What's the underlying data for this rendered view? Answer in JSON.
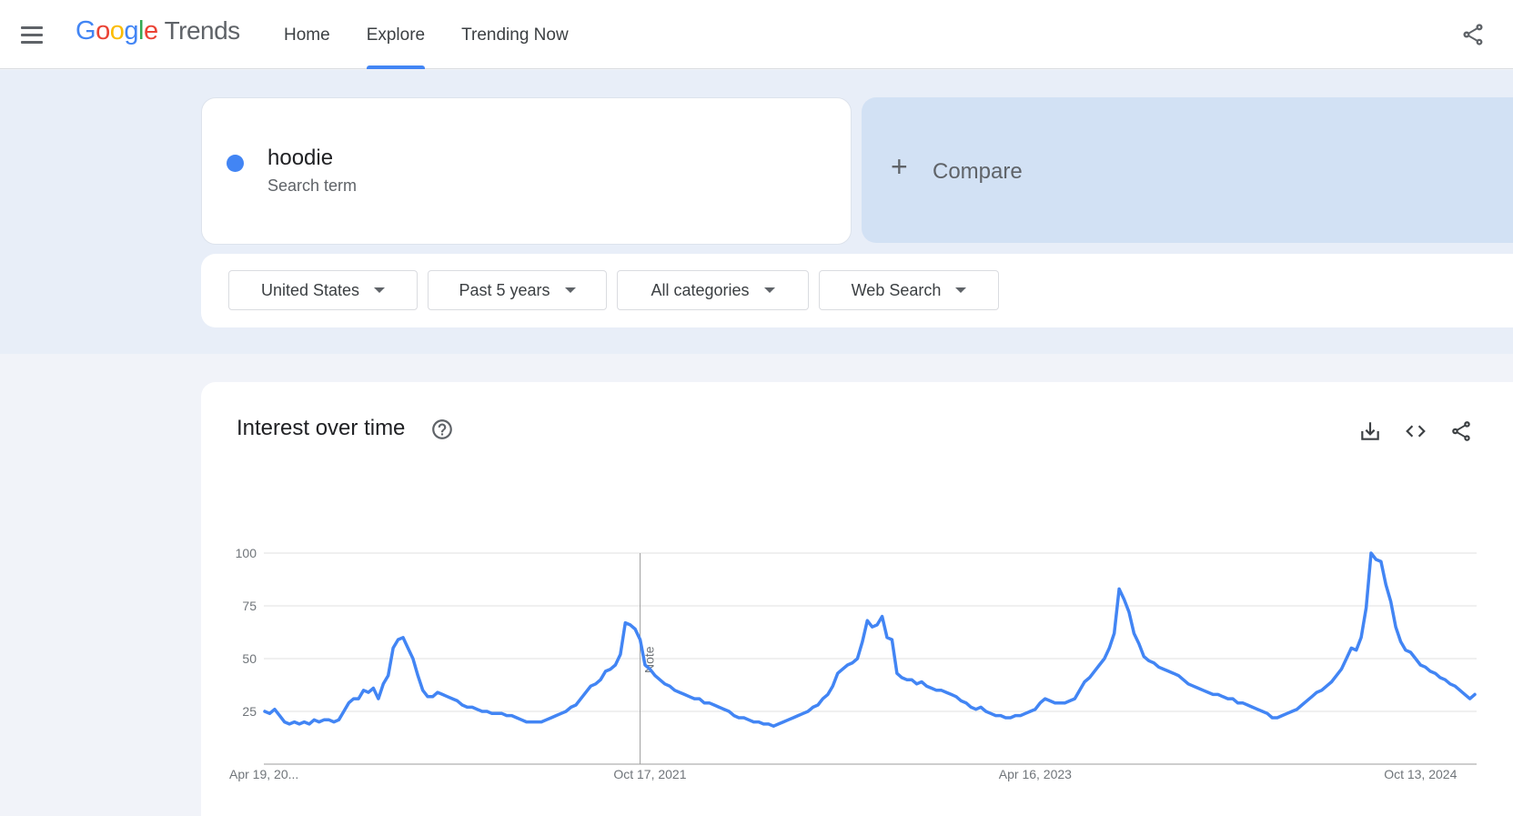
{
  "header": {
    "logo_google": [
      "G",
      "o",
      "o",
      "g",
      "l",
      "e"
    ],
    "logo_product": "Trends",
    "nav": [
      "Home",
      "Explore",
      "Trending Now"
    ]
  },
  "search": {
    "term": "hoodie",
    "term_type": "Search term",
    "term_color": "#4285f4",
    "compare_label": "Compare"
  },
  "filters": [
    "United States",
    "Past 5 years",
    "All categories",
    "Web Search"
  ],
  "chart_section": {
    "title": "Interest over time",
    "note_label": "Note"
  },
  "chart_data": {
    "type": "line",
    "title": "Interest over time",
    "x_tick_labels": [
      "Apr 19, 20...",
      "Oct 17, 2021",
      "Apr 16, 2023",
      "Oct 13, 2024"
    ],
    "y_tick_labels": [
      "100",
      "75",
      "50",
      "25"
    ],
    "ylim": [
      0,
      100
    ],
    "grid": true,
    "series": [
      {
        "name": "hoodie",
        "color": "#4285f4",
        "values": [
          25,
          24,
          26,
          23,
          20,
          19,
          20,
          19,
          20,
          19,
          21,
          20,
          21,
          21,
          20,
          21,
          25,
          29,
          31,
          31,
          35,
          34,
          36,
          31,
          38,
          42,
          55,
          59,
          60,
          55,
          50,
          42,
          35,
          32,
          32,
          34,
          33,
          32,
          31,
          30,
          28,
          27,
          27,
          26,
          25,
          25,
          24,
          24,
          24,
          23,
          23,
          22,
          21,
          20,
          20,
          20,
          20,
          21,
          22,
          23,
          24,
          25,
          27,
          28,
          31,
          34,
          37,
          38,
          40,
          44,
          45,
          47,
          52,
          67,
          66,
          64,
          59,
          47,
          45,
          42,
          40,
          38,
          37,
          35,
          34,
          33,
          32,
          31,
          31,
          29,
          29,
          28,
          27,
          26,
          25,
          23,
          22,
          22,
          21,
          20,
          20,
          19,
          19,
          18,
          19,
          20,
          21,
          22,
          23,
          24,
          25,
          27,
          28,
          31,
          33,
          37,
          43,
          45,
          47,
          48,
          50,
          58,
          68,
          65,
          66,
          70,
          60,
          59,
          43,
          41,
          40,
          40,
          38,
          39,
          37,
          36,
          35,
          35,
          34,
          33,
          32,
          30,
          29,
          27,
          26,
          27,
          25,
          24,
          23,
          23,
          22,
          22,
          23,
          23,
          24,
          25,
          26,
          29,
          31,
          30,
          29,
          29,
          29,
          30,
          31,
          35,
          39,
          41,
          44,
          47,
          50,
          55,
          62,
          83,
          78,
          72,
          62,
          57,
          51,
          49,
          48,
          46,
          45,
          44,
          43,
          42,
          40,
          38,
          37,
          36,
          35,
          34,
          33,
          33,
          32,
          31,
          31,
          29,
          29,
          28,
          27,
          26,
          25,
          24,
          22,
          22,
          23,
          24,
          25,
          26,
          28,
          30,
          32,
          34,
          35,
          37,
          39,
          42,
          45,
          50,
          55,
          54,
          60,
          74,
          100,
          97,
          96,
          85,
          77,
          65,
          58,
          54,
          53,
          50,
          47,
          46,
          44,
          43,
          41,
          40,
          38,
          37,
          35,
          33,
          31,
          33
        ]
      }
    ]
  }
}
